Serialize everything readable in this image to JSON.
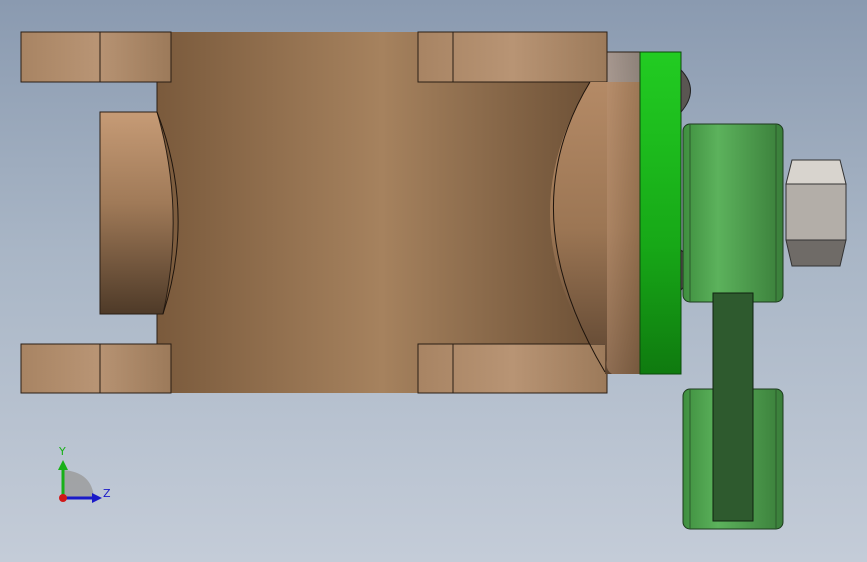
{
  "window": {
    "title": ""
  },
  "colors": {
    "background_top": "#8a9ab0",
    "background_bottom": "#c4ccd8",
    "bronze_light": "#b08868",
    "bronze_mid": "#9a7a58",
    "bronze_dark": "#6e5238",
    "green_flange": "#1fbf1f",
    "green_part": "#4aa64a",
    "green_dark": "#2e5a2e",
    "nut_light": "#d9d5cf",
    "nut_dark": "#7d7a76",
    "axis_y": "#18b018",
    "axis_z": "#1a1ac8",
    "axis_x": "#d01818"
  },
  "triad": {
    "y_label": "Y",
    "z_label": "Z"
  },
  "parts": [
    {
      "name": "valve-body",
      "icon": "body-shape"
    },
    {
      "name": "flange-seal",
      "icon": "ring-shape"
    },
    {
      "name": "handle-hub",
      "icon": "cylinder-shape"
    },
    {
      "name": "hex-nut",
      "icon": "hex-shape"
    },
    {
      "name": "lever-arm",
      "icon": "bar-shape"
    }
  ]
}
